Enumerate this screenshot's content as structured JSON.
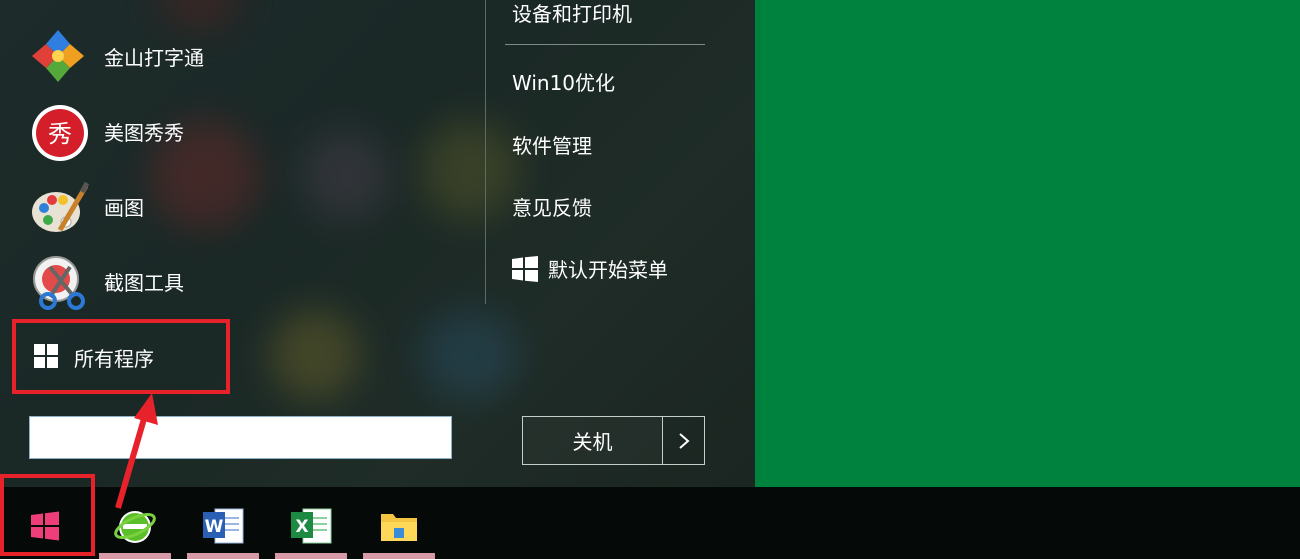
{
  "start_menu": {
    "apps": [
      {
        "label": "金山打字通",
        "icon": "jinshan-typing-icon"
      },
      {
        "label": "美图秀秀",
        "icon": "meitu-xiuxiu-icon"
      },
      {
        "label": "画图",
        "icon": "paint-icon"
      },
      {
        "label": "截图工具",
        "icon": "snipping-tool-icon"
      }
    ],
    "all_programs_label": "所有程序",
    "right_links": [
      {
        "label": "设备和打印机"
      },
      {
        "label": "Win10优化"
      },
      {
        "label": "软件管理"
      },
      {
        "label": "意见反馈"
      },
      {
        "label": "默认开始菜单",
        "icon": "windows-logo-icon"
      }
    ],
    "search_value": "",
    "shutdown_label": "关机",
    "shutdown_arrow": "›"
  },
  "taskbar": {
    "items": [
      {
        "name": "start-button",
        "icon": "windows-logo-icon"
      },
      {
        "name": "ie-browser",
        "icon": "ie-green-icon"
      },
      {
        "name": "word",
        "icon": "word-icon"
      },
      {
        "name": "excel",
        "icon": "excel-icon"
      },
      {
        "name": "file-explorer",
        "icon": "folder-icon"
      }
    ]
  },
  "colors": {
    "highlight": "#e8222a",
    "desktop": "#00823f",
    "taskbar": "#050a09",
    "start_pink": "#ef3e7a"
  }
}
